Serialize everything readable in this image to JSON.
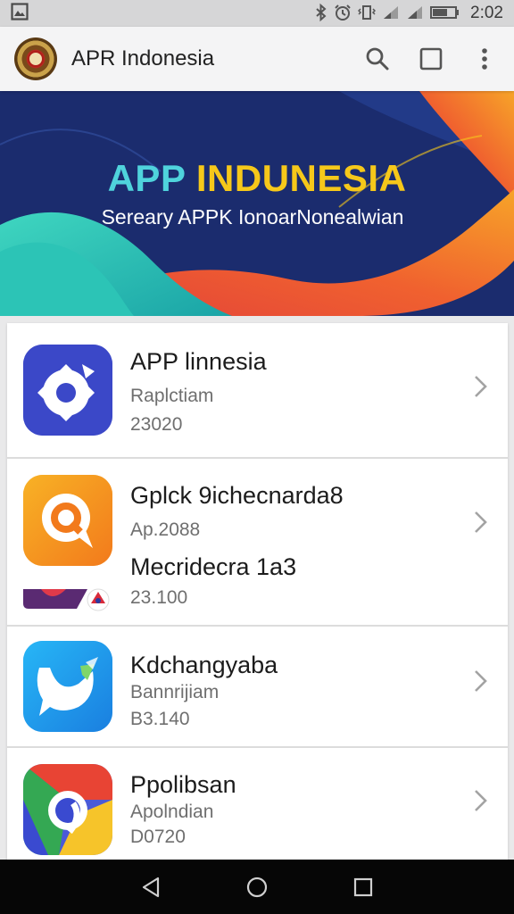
{
  "status_bar": {
    "time": "2:02",
    "icons": [
      "image-icon",
      "bluetooth-icon",
      "alarm-icon",
      "vibrate-icon",
      "signal-icon",
      "signal-icon",
      "battery-icon"
    ]
  },
  "app_bar": {
    "title": "APR Indonesia",
    "actions": [
      "search-icon",
      "square-icon",
      "more-vert-icon"
    ]
  },
  "banner": {
    "title_part1": "APP ",
    "title_part2": "INDUNESIA",
    "subtitle": "Sereary APPK IonoarNonealwian"
  },
  "apps": [
    {
      "title": "APP linnesia",
      "subtitle": "Raplctiam",
      "detail": "23020",
      "icon": "gear-icon"
    },
    {
      "title": "Gplck 9ichecnarda8",
      "subtitle": "Ap.2088",
      "title2": "Mecridecra 1a3",
      "detail": "23.100",
      "icon": "chat-icon"
    },
    {
      "title": "Kdchangyaba",
      "subtitle": "Bannrijiam",
      "detail": "B3.140",
      "icon": "message-icon"
    },
    {
      "title": "Ppolibsan",
      "subtitle": "Apolndian",
      "detail": "D0720",
      "icon": "chrome-icon"
    }
  ],
  "colors": {
    "banner_cyan": "#4fd3dc",
    "banner_yellow": "#f6c81a",
    "banner_bg": "#1a2a6a"
  },
  "nav_bar": [
    "back-icon",
    "home-icon",
    "recents-icon"
  ]
}
